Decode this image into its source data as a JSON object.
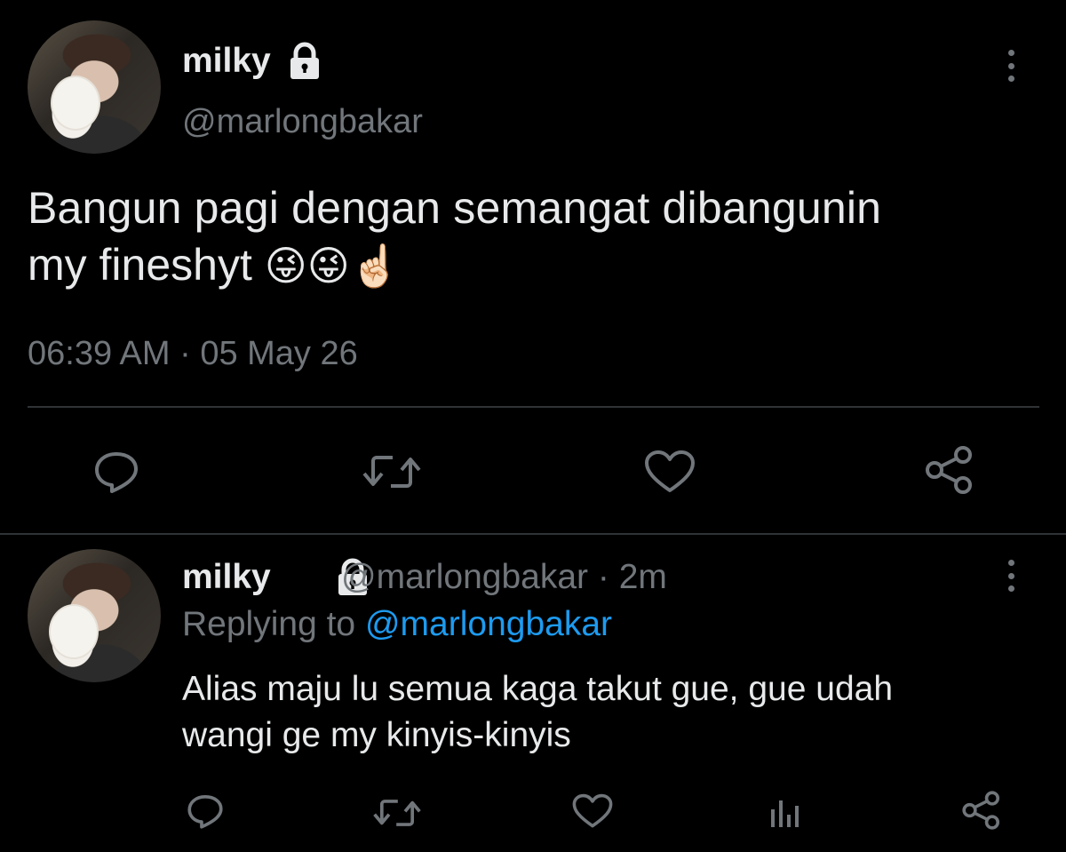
{
  "main_tweet": {
    "display_name": "milky",
    "handle": "@marlongbakar",
    "text_line1": "Bangun pagi dengan semangat dibangunin",
    "text_line2": "my fineshyt",
    "emojis": "😜😜☝🏻",
    "timestamp": "06:39 AM · 05 May 26",
    "icons": [
      "reply-icon",
      "retweet-icon",
      "like-icon",
      "share-icon"
    ]
  },
  "reply_tweet": {
    "display_name": "milky",
    "handle_time": "@marlongbakar · 2m",
    "replying_prefix": "Replying to ",
    "replying_handle": "@marlongbakar",
    "text_line1": "Alias maju lu semua kaga takut gue, gue udah",
    "text_line2": "wangi ge my kinyis-kinyis",
    "icons": [
      "reply-icon",
      "retweet-icon",
      "like-icon",
      "analytics-icon",
      "share-icon"
    ]
  },
  "colors": {
    "background": "#000000",
    "text": "#e7e9ea",
    "muted": "#71767b",
    "link": "#1d9bf0",
    "divider": "#2f3336"
  }
}
